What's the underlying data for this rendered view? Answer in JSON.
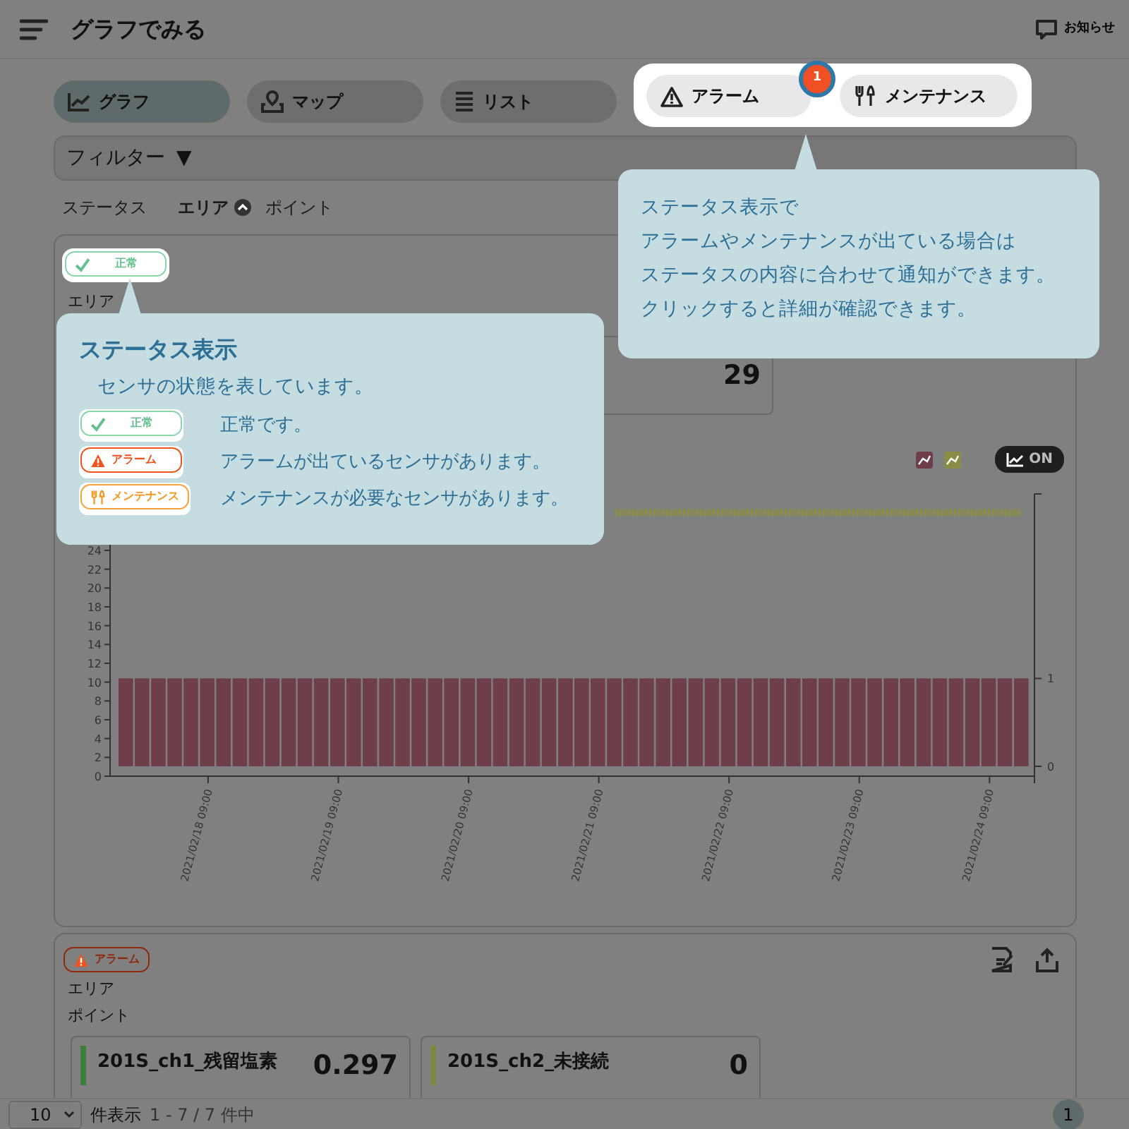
{
  "header": {
    "title": "グラフでみる",
    "notice": "お知らせ"
  },
  "tabs": [
    {
      "label": "グラフ",
      "kind": "graph",
      "selected": true
    },
    {
      "label": "マップ",
      "kind": "map",
      "selected": false
    },
    {
      "label": "リスト",
      "kind": "list",
      "selected": false
    }
  ],
  "status_tabs": [
    {
      "label": "アラーム",
      "kind": "alarm",
      "count": "1"
    },
    {
      "label": "メンテナンス",
      "kind": "maintenance"
    }
  ],
  "filter": {
    "label": "フィルター",
    "caret": "▼"
  },
  "sort": [
    {
      "label": "ステータス",
      "selected": false
    },
    {
      "label": "エリア",
      "selected": true
    },
    {
      "label": "ポイント",
      "selected": false
    }
  ],
  "cards": [
    {
      "kind": "normal",
      "status_label": "正常",
      "area_label": "エリア",
      "tile_value": "29",
      "toggle": "ON",
      "chart_data": {
        "type": "bar",
        "categories": [
          null,
          null,
          null,
          null,
          null,
          "2021/02/18 09:00",
          null,
          null,
          null,
          null,
          null,
          null,
          null,
          "2021/02/19 09:00",
          null,
          null,
          null,
          null,
          null,
          null,
          null,
          "2021/02/20 09:00",
          null,
          null,
          null,
          null,
          null,
          null,
          null,
          "2021/02/21 09:00",
          null,
          null,
          null,
          null,
          null,
          null,
          null,
          "2021/02/22 09:00",
          null,
          null,
          null,
          null,
          null,
          null,
          null,
          "2021/02/23 09:00",
          null,
          null,
          null,
          null,
          null,
          null,
          null,
          "2021/02/24 09:00",
          null,
          null
        ],
        "ylim": [
          0,
          30
        ],
        "yticks": [
          0,
          2,
          4,
          6,
          8,
          10,
          12,
          14,
          16,
          18,
          20,
          22,
          24
        ],
        "y2lim": [
          0,
          3.1
        ],
        "y2ticks": [
          0,
          1
        ],
        "series": [
          {
            "color": "#6e3f4a",
            "axis": "y2",
            "values": [
              1,
              1,
              1,
              1,
              1,
              1,
              1,
              1,
              1,
              1,
              1,
              1,
              1,
              1,
              1,
              1,
              1,
              1,
              1,
              1,
              1,
              1,
              1,
              1,
              1,
              1,
              1,
              1,
              1,
              1,
              1,
              1,
              1,
              1,
              1,
              1,
              1,
              1,
              1,
              1,
              1,
              1,
              1,
              1,
              1,
              1,
              1,
              1,
              1,
              1,
              1,
              1,
              1,
              1,
              1,
              1
            ]
          },
          {
            "color": "#8a8d45",
            "type": "line",
            "line_style": "dotted",
            "values": [
              null,
              null,
              null,
              null,
              null,
              null,
              null,
              null,
              null,
              null,
              null,
              null,
              null,
              null,
              null,
              null,
              null,
              null,
              null,
              null,
              null,
              null,
              null,
              null,
              null,
              null,
              null,
              null,
              null,
              null,
              28,
              28,
              28,
              28,
              28,
              28,
              28,
              28,
              28,
              28,
              28,
              28,
              28,
              28,
              28,
              28,
              28,
              28,
              28,
              28,
              28,
              28,
              28,
              28,
              28,
              28
            ]
          }
        ]
      }
    },
    {
      "kind": "alarm",
      "status_label": "アラーム",
      "area_label": "エリア",
      "point_label": "ポイント",
      "tiles": [
        {
          "name": "201S_ch1_残留塩素",
          "value": "0.297",
          "color": "#3f7d3a"
        },
        {
          "name": "201S_ch2_未接続",
          "value": "0",
          "color": "#7e8640"
        }
      ]
    }
  ],
  "footer": {
    "page_size": "10",
    "per_page_label": "件表示",
    "range": "1 - 7 / 7 件中",
    "pages": [
      {
        "label": "1",
        "selected": true
      }
    ]
  },
  "callouts": [
    {
      "title": "ステータス表示",
      "text": "センサの状態を表しています。",
      "legend": [
        {
          "kind": "normal",
          "label": "正常",
          "text": "正常です。"
        },
        {
          "kind": "alarm",
          "label": "アラーム",
          "text": "アラームが出ているセンサがあります。"
        },
        {
          "kind": "maintenance",
          "label": "メンテナンス",
          "text": "メンテナンスが必要なセンサがあります。"
        }
      ]
    },
    {
      "lines": [
        "ステータス表示で",
        "アラームやメンテナンスが出ている場合は",
        "ステータスの内容に合わせて通知ができます。",
        "クリックすると詳細が確認できます。"
      ]
    }
  ]
}
